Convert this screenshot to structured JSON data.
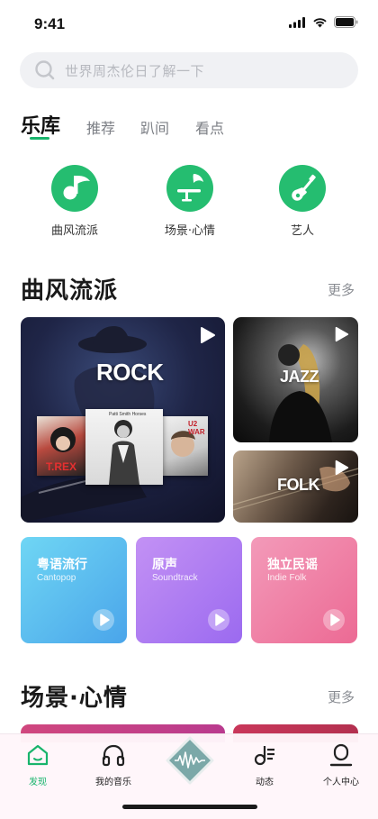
{
  "status": {
    "time": "9:41"
  },
  "search": {
    "placeholder": "世界周杰伦日了解一下"
  },
  "tabs": [
    {
      "label": "乐库",
      "active": true
    },
    {
      "label": "推荐",
      "active": false
    },
    {
      "label": "趴间",
      "active": false
    },
    {
      "label": "看点",
      "active": false
    }
  ],
  "categories": [
    {
      "label": "曲风流派",
      "icon": "music-note-icon"
    },
    {
      "label": "场景·心情",
      "icon": "scene-icon"
    },
    {
      "label": "艺人",
      "icon": "guitar-icon"
    }
  ],
  "genre_section": {
    "title": "曲风流派",
    "more": "更多",
    "cards": [
      {
        "word": "ROCK"
      },
      {
        "word": "JAZZ"
      },
      {
        "word": "FOLK"
      }
    ],
    "albums": [
      "T.REX",
      "Patti Smith  Horses",
      "U2 WAR"
    ],
    "small_cards": [
      {
        "cn": "粤语流行",
        "en": "Cantopop",
        "color_from": "#6fd6f4",
        "color_to": "#4aa5ea"
      },
      {
        "cn": "原声",
        "en": "Soundtrack",
        "color_from": "#c391f4",
        "color_to": "#9b6af0"
      },
      {
        "cn": "独立民谣",
        "en": "Indie Folk",
        "color_from": "#f39ab9",
        "color_to": "#ec6a94"
      }
    ]
  },
  "scene_section": {
    "title": "场景·心情",
    "more": "更多"
  },
  "tabbar": [
    {
      "label": "发现",
      "icon": "home-icon",
      "active": true
    },
    {
      "label": "我的音乐",
      "icon": "headphones-icon",
      "active": false
    },
    {
      "label": "",
      "icon": "now-playing-icon",
      "active": false
    },
    {
      "label": "动态",
      "icon": "music-feed-icon",
      "active": false
    },
    {
      "label": "个人中心",
      "icon": "profile-icon",
      "active": false
    }
  ],
  "colors": {
    "accent": "#18b46c",
    "icon_green": "#25bd70"
  }
}
